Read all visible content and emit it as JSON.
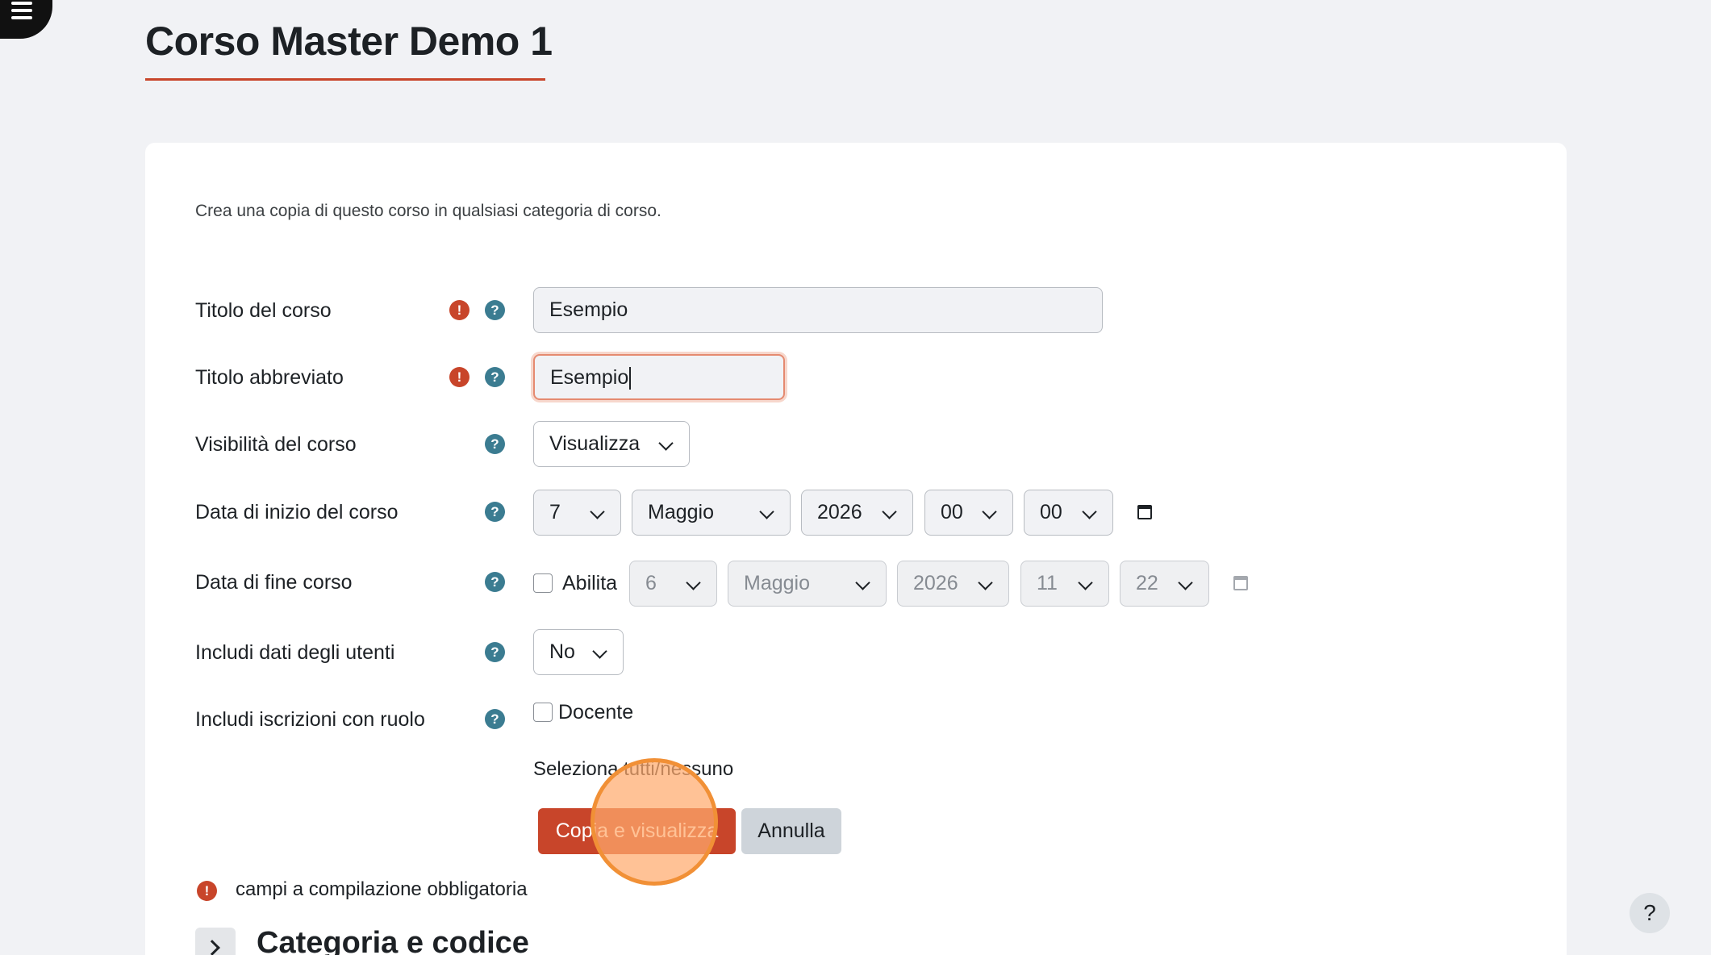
{
  "page": {
    "title": "Corso Master Demo 1"
  },
  "intro": "Crea una copia di questo corso in qualsiasi categoria di corso.",
  "icons": {
    "required": "!",
    "help": "?"
  },
  "fields": {
    "fullname": {
      "label": "Titolo del corso",
      "value": "Esempio"
    },
    "shortname": {
      "label": "Titolo abbreviato",
      "value": "Esempio"
    },
    "visibility": {
      "label": "Visibilità del corso",
      "value": "Visualizza"
    },
    "startdate": {
      "label": "Data di inizio del corso",
      "day": "7",
      "month": "Maggio",
      "year": "2026",
      "hour": "00",
      "minute": "00"
    },
    "enddate": {
      "label": "Data di fine corso",
      "enable_label": "Abilita",
      "day": "6",
      "month": "Maggio",
      "year": "2026",
      "hour": "11",
      "minute": "22"
    },
    "userdata": {
      "label": "Includi dati degli utenti",
      "value": "No"
    },
    "roles": {
      "label": "Includi iscrizioni con ruolo",
      "option": "Docente"
    }
  },
  "select_all_link": "Seleziona tutti/nessuno",
  "buttons": {
    "submit": "Copia e visualizza",
    "cancel": "Annulla"
  },
  "required_note": "campi a compilazione obbligatoria",
  "section": {
    "title": "Categoria e codice"
  },
  "help_fab": "?",
  "colors": {
    "accent": "#c8452a",
    "help_icon": "#3b7c91",
    "background": "#f1f2f5"
  }
}
